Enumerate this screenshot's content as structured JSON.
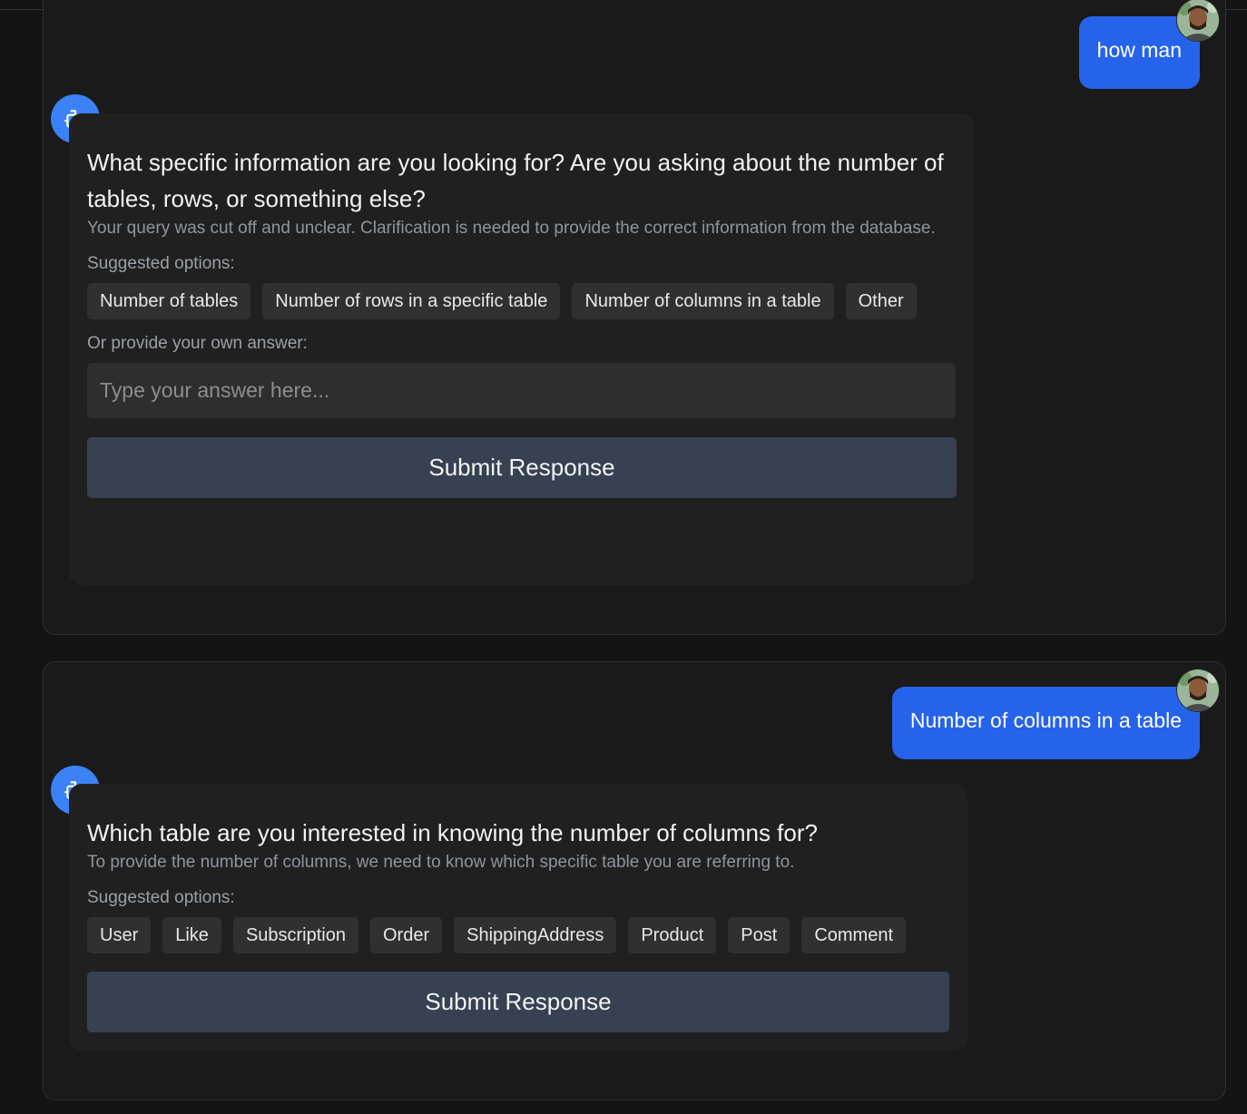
{
  "colors": {
    "page_bg": "#141414",
    "panel_bg": "#1a1a1a",
    "user_bubble": "#2563eb",
    "bot_icon_bg": "#3b82f6",
    "card_bg": "#202020",
    "chip_bg": "#303030",
    "submit_bg": "#374151"
  },
  "conversation": [
    {
      "user_message": "how man",
      "avatar_icon": "user-avatar",
      "bot_icon": "robot-icon",
      "question": "What specific information are you looking for? Are you asking about the number of tables, rows, or something else?",
      "reason": "Your query was cut off and unclear. Clarification is needed to provide the correct information from the database.",
      "options_label": "Suggested options:",
      "options": [
        "Number of tables",
        "Number of rows in a specific table",
        "Number of columns in a table",
        "Other"
      ],
      "custom_answer_label": "Or provide your own answer:",
      "input_placeholder": "Type your answer here...",
      "submit_label": "Submit Response"
    },
    {
      "user_message": "Number of columns in a table",
      "avatar_icon": "user-avatar",
      "bot_icon": "robot-icon",
      "question": "Which table are you interested in knowing the number of columns for?",
      "reason": "To provide the number of columns, we need to know which specific table you are referring to.",
      "options_label": "Suggested options:",
      "options": [
        "User",
        "Like",
        "Subscription",
        "Order",
        "ShippingAddress",
        "Product",
        "Post",
        "Comment"
      ],
      "submit_label": "Submit Response"
    }
  ]
}
